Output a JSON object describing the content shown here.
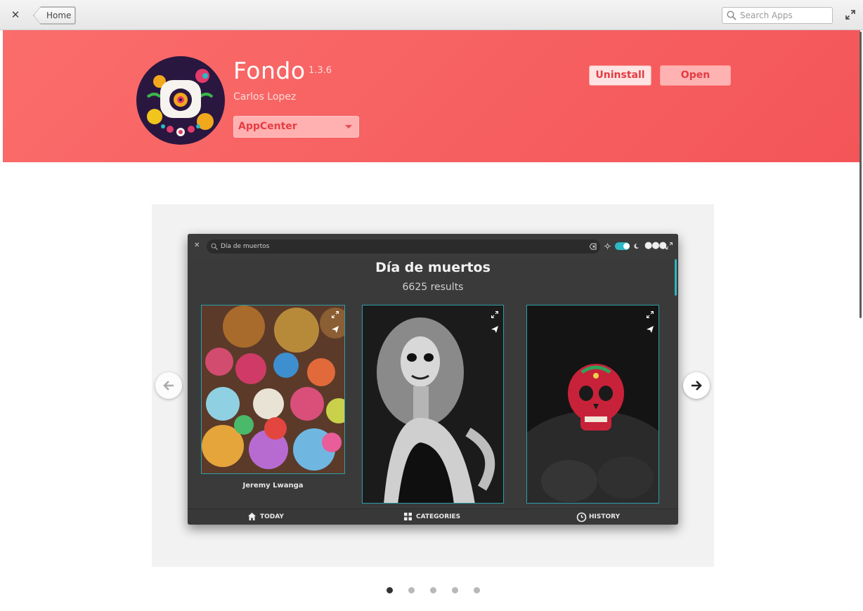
{
  "header": {
    "home_label": "Home",
    "search_placeholder": "Search Apps"
  },
  "app": {
    "name": "Fondo",
    "version": "1.3.6",
    "author": "Carlos Lopez",
    "origin": "AppCenter",
    "uninstall_label": "Uninstall",
    "open_label": "Open",
    "accent_color": "#f45558"
  },
  "screenshot": {
    "search_text": "Día de muertos",
    "title": "Día de muertos",
    "results": "6625 results",
    "tile_caption": "Jeremy Lwanga",
    "nav": {
      "today": "TODAY",
      "categories": "CATEGORIES",
      "history": "HISTORY"
    },
    "accent_color": "#2cb9c5"
  },
  "carousel": {
    "page_count": 5,
    "active_index": 0
  }
}
